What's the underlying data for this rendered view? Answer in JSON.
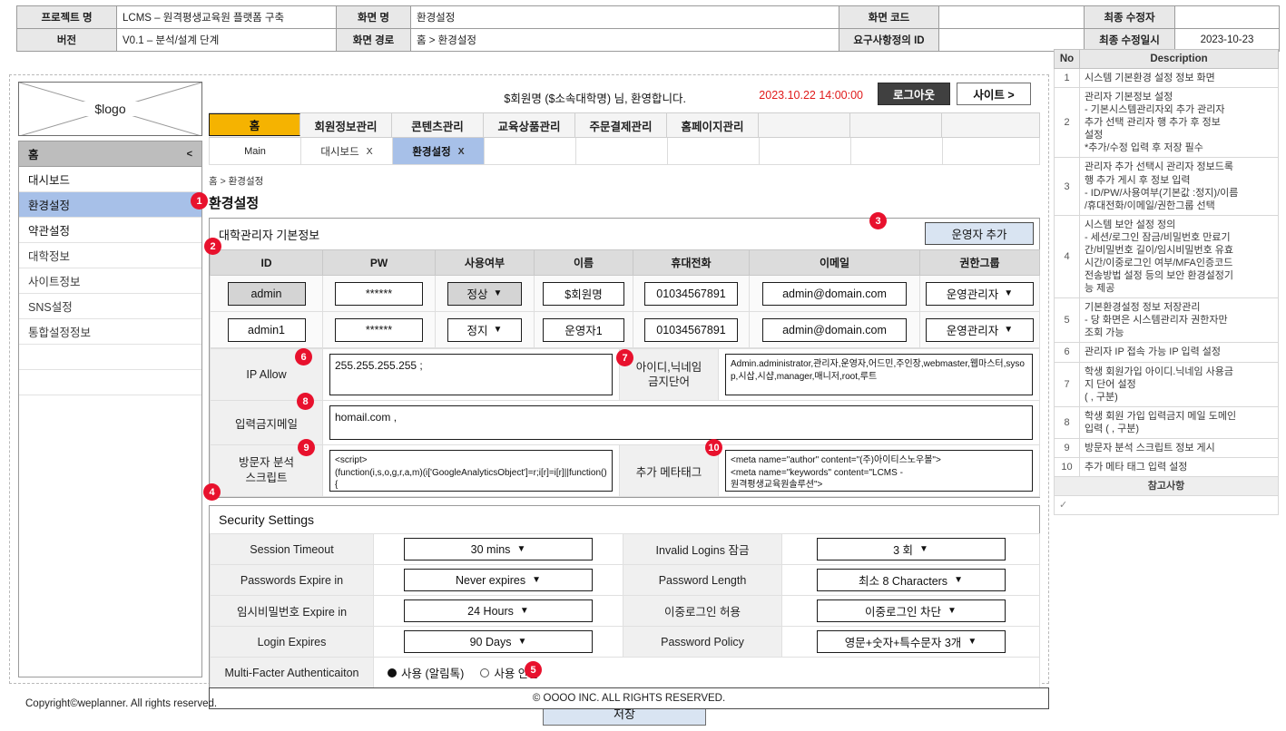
{
  "meta": {
    "rows": [
      {
        "l1": "프로젝트 명",
        "v1": "LCMS – 원격평생교육원 플랫폼 구축",
        "l2": "화면 명",
        "v2": "환경설정",
        "l3": "화면 코드",
        "v3": "",
        "l4": "최종 수정자",
        "v4": ""
      },
      {
        "l1": "버전",
        "v1": "V0.1 – 분석/설계 단계",
        "l2": "화면 경로",
        "v2": "홈 > 환경설정",
        "l3": "요구사항정의 ID",
        "v3": "",
        "l4": "최종 수정일시",
        "v4": "2023-10-23"
      }
    ]
  },
  "description_panel": {
    "header_no": "No",
    "header_desc": "Description",
    "rows": [
      {
        "no": "1",
        "text": "시스템  기본환경 설정 정보 화면"
      },
      {
        "no": "2",
        "text": "관리자 기본정보 설정\n-     기본시스템관리자외 추가 관리자\n      추가 선택 관리자 행 추가 후 정보\n      설정\n*추가/수정 입력 후 저장 필수"
      },
      {
        "no": "3",
        "text": "관리자 추가 선택시 관리자 정보드록\n행 추가 게시 후 정보 입력\n- ID/PW/사용여부(기본값 :정지)/이름\n/휴대전화/이메일/권한그룹 선택"
      },
      {
        "no": "4",
        "text": "시스템 보안 설정 정의\n- 세션/로그인 잠금/비밀번호 만료기\n간/비밀번호 길이/임시비밀번호 유효\n시간/이중로그인 여부/MFA인증코드\n전송방법 설정 등의  보안 환경설정기\n능 제공"
      },
      {
        "no": "5",
        "text": "기본환경설정 정보 저장관리\n- 당 화면은 시스템관리자 권한자만\n조회 가능"
      },
      {
        "no": "6",
        "text": "관리자 IP 접속 가능 IP 입력 설정"
      },
      {
        "no": "7",
        "text": "학생 회원가입 아이디.닉네임 사용금\n지 단어 설정\n( , 구분)"
      },
      {
        "no": "8",
        "text": "학생 회원 가입 입력금지 메일 도메인\n입력 ( , 구분)"
      },
      {
        "no": "9",
        "text": "방문자 분석 스크립트 정보 게시"
      },
      {
        "no": "10",
        "text": "추가 메타 태그 입력 설정"
      }
    ],
    "note_label": "참고사항",
    "note_check": "✓"
  },
  "logo": {
    "text": "$logo"
  },
  "sidebar": {
    "head_label": "홈",
    "collapse_icon": "<",
    "items": [
      {
        "label": "대시보드",
        "active": false
      },
      {
        "label": "환경설정",
        "active": true
      },
      {
        "label": "약관설정",
        "active": false
      },
      {
        "label": "대학정보",
        "active": false
      },
      {
        "label": "사이트정보",
        "active": false
      },
      {
        "label": "SNS설정",
        "active": false
      },
      {
        "label": "통합설정정보",
        "active": false
      }
    ]
  },
  "header": {
    "greeting": "$회원명 ($소속대학명) 님, 환영합니다.",
    "datetime": "2023.10.22 14:00:00",
    "logout_label": "로그아웃",
    "site_label": "사이트 >"
  },
  "gnb": {
    "items": [
      {
        "label": "홈",
        "selected": true
      },
      {
        "label": "회원정보관리",
        "selected": false
      },
      {
        "label": "콘텐츠관리",
        "selected": false
      },
      {
        "label": "교육상품관리",
        "selected": false
      },
      {
        "label": "주문결제관리",
        "selected": false
      },
      {
        "label": "홈페이지관리",
        "selected": false
      }
    ]
  },
  "tabs": {
    "main_label": "Main",
    "items": [
      {
        "label": "대시보드",
        "close": "X",
        "active": false
      },
      {
        "label": "환경설정",
        "close": "X",
        "active": true
      }
    ]
  },
  "page": {
    "breadcrumb": "홈 > 환경설정",
    "title": "환경설정"
  },
  "admin_card": {
    "title": "대학관리자 기본정보",
    "add_button": "운영자 추가",
    "columns": [
      "ID",
      "PW",
      "사용여부",
      "이름",
      "휴대전화",
      "이메일",
      "권한그룹"
    ],
    "rows": [
      {
        "id": "admin",
        "pw": "******",
        "use": "정상",
        "name": "$회원명",
        "phone": "01034567891",
        "email": "admin@domain.com",
        "group": "운영관리자",
        "id_gray": true,
        "use_gray": true
      },
      {
        "id": "admin1",
        "pw": "******",
        "use": "정지",
        "name": "운영자1",
        "phone": "01034567891",
        "email": "admin@domain.com",
        "group": "운영관리자",
        "id_gray": false,
        "use_gray": false
      }
    ],
    "caret": "▼"
  },
  "form": {
    "ip_allow_label": "IP Allow",
    "ip_allow_value": "255.255.255.255 ;",
    "banned_words_label": "아이디,닉네임\n금지단어",
    "banned_words_value": "Admin.administrator,관리자,운영자,어드민,주인장,webmaster,웹마스터,sysop,시삽,시샵,manager,매니저,root,루트",
    "banned_mail_label": "입력금지메일",
    "banned_mail_value": "homail.com ,",
    "analytics_label": "방문자 분석\n스크립트",
    "analytics_value": "<script>\n(function(i,s,o,g,r,a,m)(i['GoogleAnalyticsObject']=r;i[r]=i[r]||function()\n{",
    "metatag_label": "추가 메타태그",
    "metatag_value": "<meta name=\"author\" content=\"(주)아이티스노우볼\">\n<meta name=\"keywords\" content=\"LCMS -\n원격평생교육원솔루션\">"
  },
  "security": {
    "title": "Security Settings",
    "rows": [
      {
        "l_label": "Session Timeout",
        "l_value": "30 mins",
        "r_label": "Invalid Logins 잠금",
        "r_value": "3 회"
      },
      {
        "l_label": "Passwords Expire in",
        "l_value": "Never expires",
        "r_label": "Password Length",
        "r_value": "최소 8 Characters"
      },
      {
        "l_label": "임시비밀번호 Expire in",
        "l_value": "24 Hours",
        "r_label": "이중로그인 허용",
        "r_value": "이중로그인 차단"
      },
      {
        "l_label": "Login Expires",
        "l_value": "90 Days",
        "r_label": "Password Policy",
        "r_value": "영문+숫자+특수문자 3개"
      }
    ],
    "mfa_label": "Multi-Facter Authenticaiton",
    "mfa_option_on": "사용 (알림톡)",
    "mfa_option_off": "사용 안함",
    "caret": "▼"
  },
  "save_button": "저장",
  "footer": {
    "center": "© OOOO INC. ALL RIGHTS RESERVED.",
    "copyright": "Copyright©weplanner. All rights reserved."
  },
  "badges": [
    "1",
    "2",
    "3",
    "4",
    "5",
    "6",
    "7",
    "8",
    "9",
    "10"
  ],
  "colors": {
    "accent_yellow": "#f5b301",
    "tab_blue": "#a7c0e8",
    "badge_red": "#e8112d",
    "time_red": "#e01b1b"
  }
}
